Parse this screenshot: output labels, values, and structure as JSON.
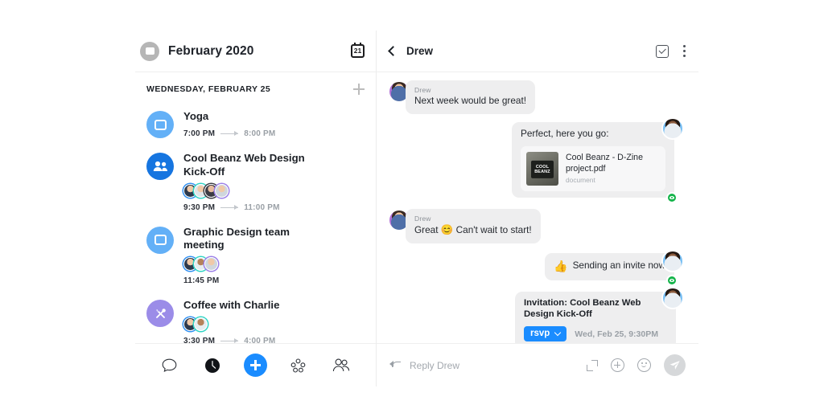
{
  "calendar": {
    "header": {
      "avatar_icon": "user-avatar-icon",
      "title": "February 2020",
      "date_icon_label": "21"
    },
    "day_header": "WEDNESDAY, FEBRUARY 25",
    "add_label": "+",
    "events": [
      {
        "title": "Yoga",
        "icon": "calendar-event-icon",
        "icon_color": "#63b0f7",
        "start": "7:00 PM",
        "end": "8:00 PM",
        "attendees": 0
      },
      {
        "title": "Cool Beanz Web Design Kick-Off",
        "icon": "group-event-icon",
        "icon_color": "#1675e0",
        "start": "9:30 PM",
        "end": "11:00 PM",
        "attendees": 4
      },
      {
        "title": "Graphic Design team meeting",
        "icon": "calendar-event-icon",
        "icon_color": "#63b0f7",
        "start": "11:45 PM",
        "end": "",
        "attendees": 3
      },
      {
        "title": "Coffee with Charlie",
        "icon": "food-event-icon",
        "icon_color": "#9b8ce8",
        "start": "3:30 PM",
        "end": "4:00 PM",
        "attendees": 2
      }
    ],
    "nav": [
      {
        "name": "chat-tab",
        "icon": "chat-bubble-icon",
        "active": false
      },
      {
        "name": "clock-tab",
        "icon": "clock-icon",
        "active": true
      },
      {
        "name": "create-button",
        "icon": "plus-icon",
        "active": false
      },
      {
        "name": "apps-tab",
        "icon": "cluster-icon",
        "active": false
      },
      {
        "name": "contacts-tab",
        "icon": "people-icon",
        "active": false
      }
    ]
  },
  "chat": {
    "header": {
      "back_icon": "back-chevron-icon",
      "name": "Drew",
      "task_icon": "checkbox-task-icon",
      "menu_icon": "more-vertical-icon"
    },
    "messages": [
      {
        "direction": "in",
        "sender": "Drew",
        "text": "Next week would be great!",
        "status": ""
      },
      {
        "direction": "out",
        "sender": "",
        "text": "Perfect, here you go:",
        "attachment": {
          "name": "Cool Beanz - D-Zine project.pdf",
          "type": "document",
          "thumb_label": "COOL BEANZ"
        },
        "status": "seen"
      },
      {
        "direction": "in",
        "sender": "Drew",
        "text_before": "Great",
        "emoji": "😊",
        "text_after": "Can't wait to start!",
        "status": ""
      },
      {
        "direction": "out",
        "sender": "",
        "emoji": "👍",
        "text": "Sending an invite now",
        "status": "seen"
      },
      {
        "direction": "out",
        "type": "invitation",
        "title": "Invitation: Cool Beanz Web Design Kick-Off",
        "rsvp_label": "rsvp",
        "date": "Wed, Feb 25, 9:30PM",
        "status": "confirmed"
      }
    ],
    "composer": {
      "reply_icon": "reply-arrow-icon",
      "placeholder": "Reply Drew",
      "expand_icon": "expand-icon",
      "attach_icon": "plus-circle-icon",
      "emoji_icon": "smiley-icon",
      "send_icon": "send-plane-icon"
    }
  },
  "colors": {
    "accent": "#1a8cff",
    "seen_green": "#14b44a",
    "confirm_green": "#35c46a",
    "bubble_gray": "#eeeeef"
  }
}
